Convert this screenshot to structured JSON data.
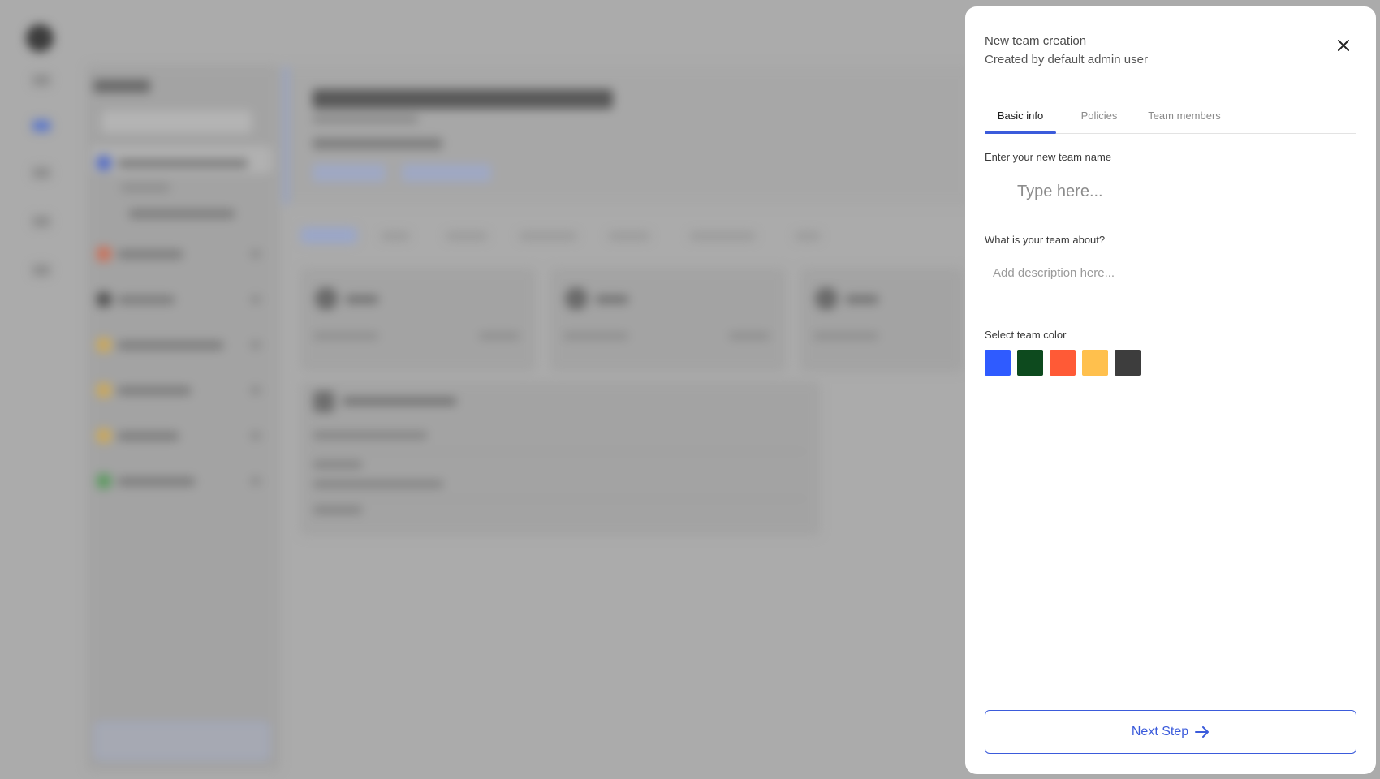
{
  "panel": {
    "title": "New team creation",
    "subtitle": "Created by default admin user",
    "close_icon": "close-icon"
  },
  "tabs": [
    {
      "label": "Basic info",
      "active": true
    },
    {
      "label": "Policies",
      "active": false
    },
    {
      "label": "Team members",
      "active": false
    }
  ],
  "form": {
    "name_label": "Enter your new team name",
    "name_placeholder": "Type here...",
    "name_value": "",
    "description_label": "What is your team about?",
    "description_placeholder": "Add description here...",
    "description_value": "",
    "color_label": "Select team color",
    "colors": [
      "#2f5bff",
      "#0d4a1e",
      "#ff5a36",
      "#ffc04d",
      "#3d3d3d"
    ]
  },
  "footer": {
    "next_label": "Next Step",
    "next_icon": "arrow-right-icon"
  },
  "theme": {
    "accent": "#3b5bdb"
  }
}
